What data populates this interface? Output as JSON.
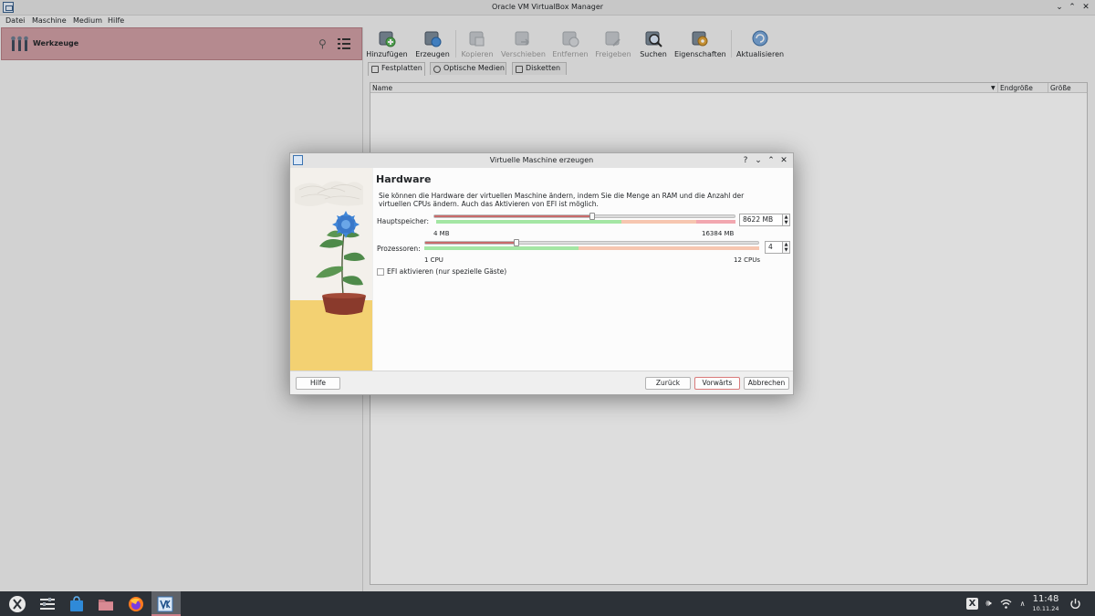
{
  "window": {
    "title": "Oracle VM VirtualBox Manager"
  },
  "menu": [
    "Datei",
    "Maschine",
    "Medium",
    "Hilfe"
  ],
  "tools": {
    "label": "Werkzeuge"
  },
  "toolbar": [
    {
      "label": "Hinzufügen",
      "enabled": true,
      "icon": "add-icon"
    },
    {
      "label": "Erzeugen",
      "enabled": true,
      "icon": "create-icon"
    },
    {
      "label": "Kopieren",
      "enabled": false,
      "icon": "copy-icon"
    },
    {
      "label": "Verschieben",
      "enabled": false,
      "icon": "move-icon"
    },
    {
      "label": "Entfernen",
      "enabled": false,
      "icon": "remove-icon"
    },
    {
      "label": "Freigeben",
      "enabled": false,
      "icon": "release-icon"
    },
    {
      "label": "Suchen",
      "enabled": true,
      "icon": "search-icon"
    },
    {
      "label": "Eigenschaften",
      "enabled": true,
      "icon": "properties-icon"
    },
    {
      "label": "Aktualisieren",
      "enabled": true,
      "icon": "refresh-icon"
    }
  ],
  "tabs": [
    {
      "label": "Festplatten",
      "active": true
    },
    {
      "label": "Optische Medien",
      "active": false
    },
    {
      "label": "Disketten",
      "active": false
    }
  ],
  "table": {
    "columns": [
      "Name",
      "Endgröße",
      "Größe"
    ]
  },
  "dialog": {
    "title": "Virtuelle Maschine erzeugen",
    "heading": "Hardware",
    "description": "Sie können die Hardware der virtuellen Maschine ändern, indem Sie die Menge an RAM und die Anzahl der virtuellen CPUs ändern. Auch das Aktivieren von EFI ist möglich.",
    "memory": {
      "label": "Hauptspeicher:",
      "value": "8622 MB",
      "min_label": "4 MB",
      "max_label": "16384 MB",
      "fraction": 0.526
    },
    "processors": {
      "label": "Prozessoren:",
      "value": "4",
      "min_label": "1 CPU",
      "max_label": "12 CPUs",
      "fraction": 0.2727
    },
    "efi": {
      "label": "EFI aktivieren (nur spezielle Gäste)",
      "checked": false
    },
    "buttons": {
      "help": "Hilfe",
      "back": "Zurück",
      "next": "Vorwärts",
      "cancel": "Abbrechen"
    }
  },
  "taskbar": {
    "time": "11:48",
    "date": "10.11.24"
  },
  "colors": {
    "tools_header": "#cf9ea3",
    "accent": "#c97d86",
    "taskbar": "#2c3137"
  }
}
